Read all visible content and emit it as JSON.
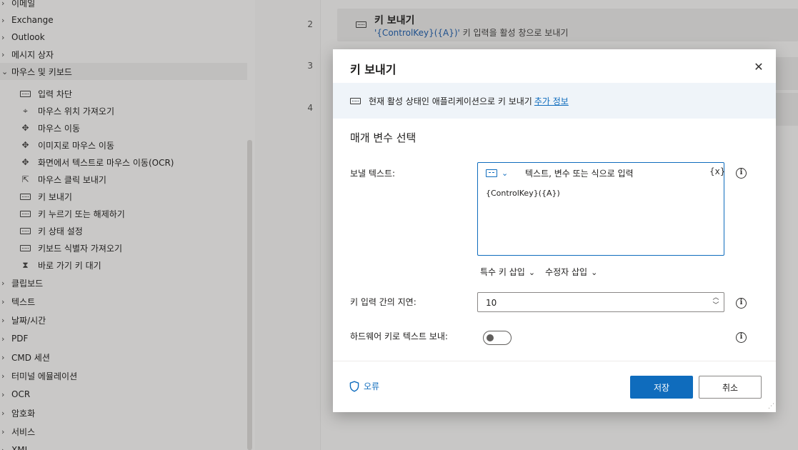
{
  "sidebar": {
    "groups_top": [
      {
        "label": "이메일",
        "chevron": "›"
      },
      {
        "label": "Exchange",
        "chevron": "›"
      },
      {
        "label": "Outlook",
        "chevron": "›"
      },
      {
        "label": "메시지 상자",
        "chevron": "›"
      },
      {
        "label": "마우스 및 키보드",
        "chevron": "⌄"
      }
    ],
    "children": [
      {
        "label": "입력 차단",
        "icon": "keyboard-icon"
      },
      {
        "label": "마우스 위치 가져오기",
        "icon": "crosshair-icon"
      },
      {
        "label": "마우스 이동",
        "icon": "mouse-move-icon"
      },
      {
        "label": "이미지로 마우스 이동",
        "icon": "mouse-move-icon"
      },
      {
        "label": "화면에서 텍스트로 마우스 이동(OCR)",
        "icon": "mouse-move-icon"
      },
      {
        "label": "마우스 클릭 보내기",
        "icon": "mouse-click-icon"
      },
      {
        "label": "키 보내기",
        "icon": "keyboard-icon"
      },
      {
        "label": "키 누르기 또는 해제하기",
        "icon": "keyboard-icon"
      },
      {
        "label": "키 상태 설정",
        "icon": "keyboard-icon"
      },
      {
        "label": "키보드 식별자 가져오기",
        "icon": "keyboard-icon"
      },
      {
        "label": "바로 가기 키 대기",
        "icon": "hourglass-icon"
      }
    ],
    "groups_bottom": [
      {
        "label": "클립보드",
        "chevron": "›"
      },
      {
        "label": "텍스트",
        "chevron": "›"
      },
      {
        "label": "날짜/시간",
        "chevron": "›"
      },
      {
        "label": "PDF",
        "chevron": "›"
      },
      {
        "label": "CMD 세션",
        "chevron": "›"
      },
      {
        "label": "터미널 에뮬레이션",
        "chevron": "›"
      },
      {
        "label": "OCR",
        "chevron": "›"
      },
      {
        "label": "암호화",
        "chevron": "›"
      },
      {
        "label": "서비스",
        "chevron": "›"
      },
      {
        "label": "XML",
        "chevron": "›"
      }
    ]
  },
  "flow": {
    "line_numbers": [
      "2",
      "3",
      "4"
    ],
    "step": {
      "title": "키 보내기",
      "value": "'{ControlKey}({A})'",
      "desc": " 키 입력을 활성 창으로 보내기"
    }
  },
  "dialog": {
    "title": "키 보내기",
    "close_glyph": "✕",
    "info_text": "현재 활성 상태인 애플리케이션으로 키 보내기",
    "info_link": "추가 정보",
    "section_title": "매개 변수 선택",
    "text_to_send": {
      "label": "보낼 텍스트:",
      "placeholder": "텍스트, 변수 또는 식으로 입력",
      "var_button": "{x}",
      "value": "{ControlKey}({A})"
    },
    "insert_special_key": "특수 키 삽입",
    "insert_modifier": "수정자 삽입",
    "delay": {
      "label": "키 입력 간의 지연:",
      "value": "10"
    },
    "hardware_keys": {
      "label": "하드웨어 키로 텍스트 보내:",
      "enabled": false
    },
    "info_glyph": "i",
    "error_label": "오류",
    "save_label": "저장",
    "cancel_label": "취소"
  },
  "colors": {
    "accent": "#0f6cbd",
    "info_bar_bg": "#eff4f9"
  }
}
